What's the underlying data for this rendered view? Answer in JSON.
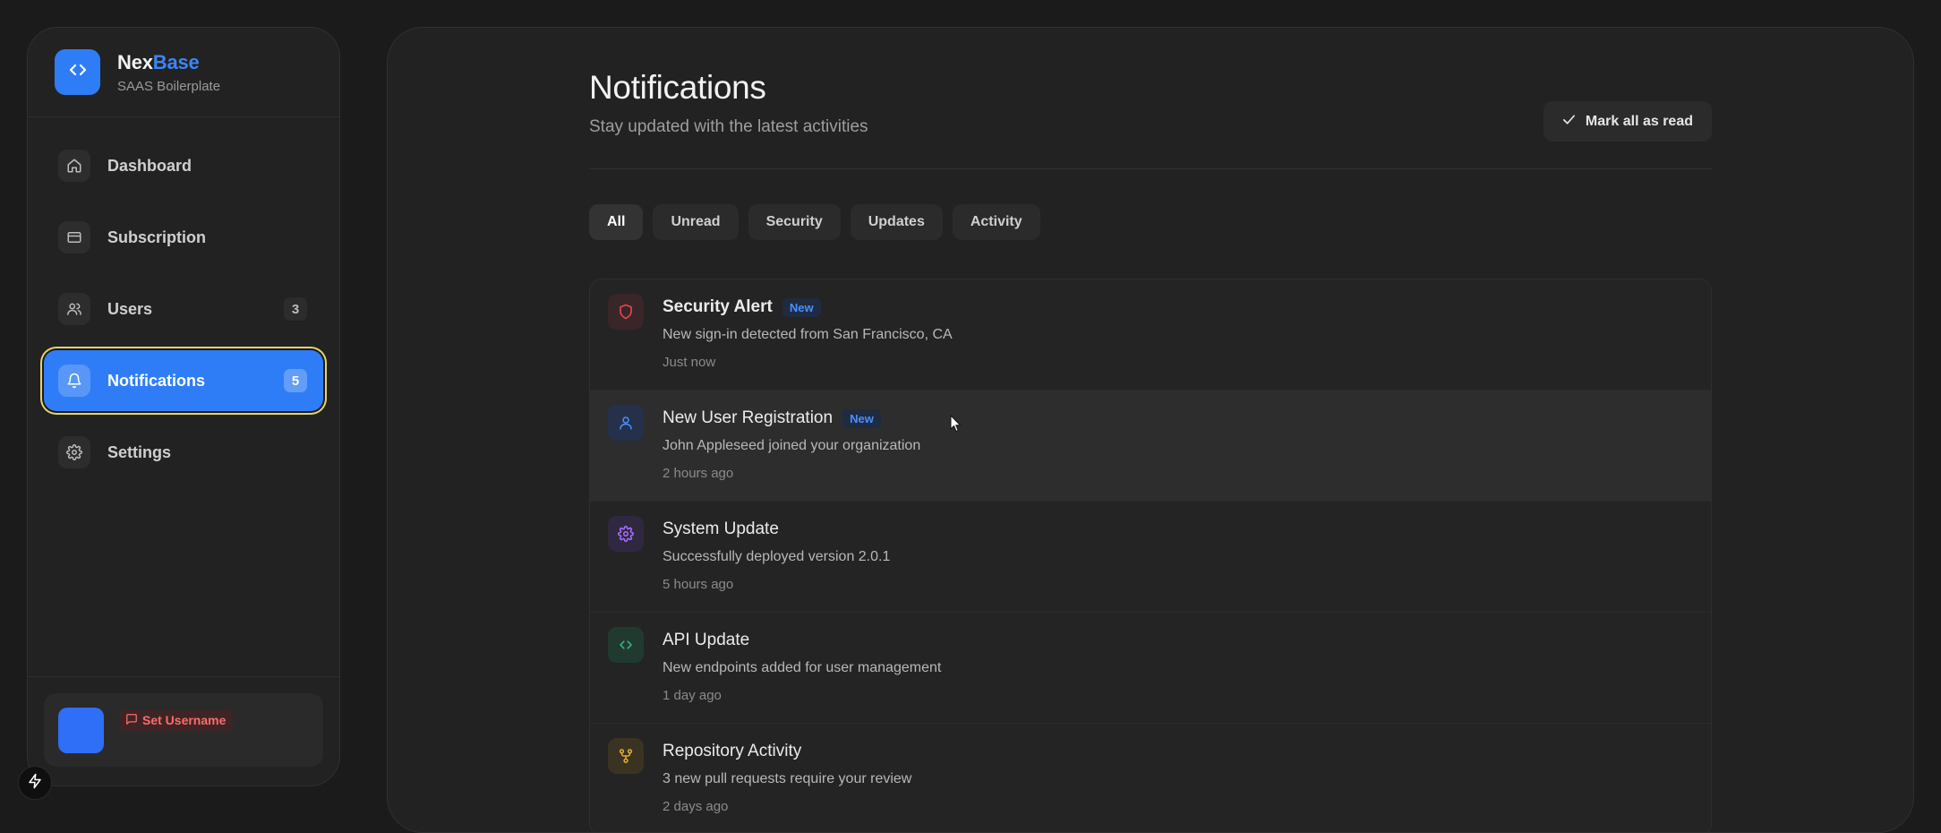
{
  "brand": {
    "name_primary": "Nex",
    "name_accent": "Base",
    "subtitle": "SAAS Boilerplate",
    "logo_icon": "code-brackets-icon"
  },
  "sidebar": {
    "items": [
      {
        "label": "Dashboard",
        "icon": "home-icon",
        "count": null,
        "active": false
      },
      {
        "label": "Subscription",
        "icon": "credit-card-icon",
        "count": null,
        "active": false
      },
      {
        "label": "Users",
        "icon": "users-icon",
        "count": "3",
        "active": false
      },
      {
        "label": "Notifications",
        "icon": "bell-icon",
        "count": "5",
        "active": true
      },
      {
        "label": "Settings",
        "icon": "gear-icon",
        "count": null,
        "active": false
      }
    ],
    "user": {
      "set_username_label": "Set Username"
    }
  },
  "header": {
    "title": "Notifications",
    "subtitle": "Stay updated with the latest activities",
    "mark_all_label": "Mark all as read"
  },
  "tabs": [
    {
      "label": "All",
      "active": true
    },
    {
      "label": "Unread",
      "active": false
    },
    {
      "label": "Security",
      "active": false
    },
    {
      "label": "Updates",
      "active": false
    },
    {
      "label": "Activity",
      "active": false
    }
  ],
  "notifications": [
    {
      "title": "Security Alert",
      "badge": "New",
      "description": "New sign-in detected from San Francisco, CA",
      "time": "Just now",
      "icon": "shield-icon"
    },
    {
      "title": "New User Registration",
      "badge": "New",
      "description": "John Appleseed joined your organization",
      "time": "2 hours ago",
      "icon": "user-icon"
    },
    {
      "title": "System Update",
      "badge": "",
      "description": "Successfully deployed version 2.0.1",
      "time": "5 hours ago",
      "icon": "gear-icon"
    },
    {
      "title": "API Update",
      "badge": "",
      "description": "New endpoints added for user management",
      "time": "1 day ago",
      "icon": "code-brackets-icon"
    },
    {
      "title": "Repository Activity",
      "badge": "",
      "description": "3 new pull requests require your review",
      "time": "2 days ago",
      "icon": "git-fork-icon"
    }
  ],
  "colors": {
    "accent": "#2f7df6",
    "security": "#e5484d",
    "user": "#4a90ff",
    "system": "#a970ff",
    "api": "#30b07a",
    "repo": "#e0b030"
  }
}
